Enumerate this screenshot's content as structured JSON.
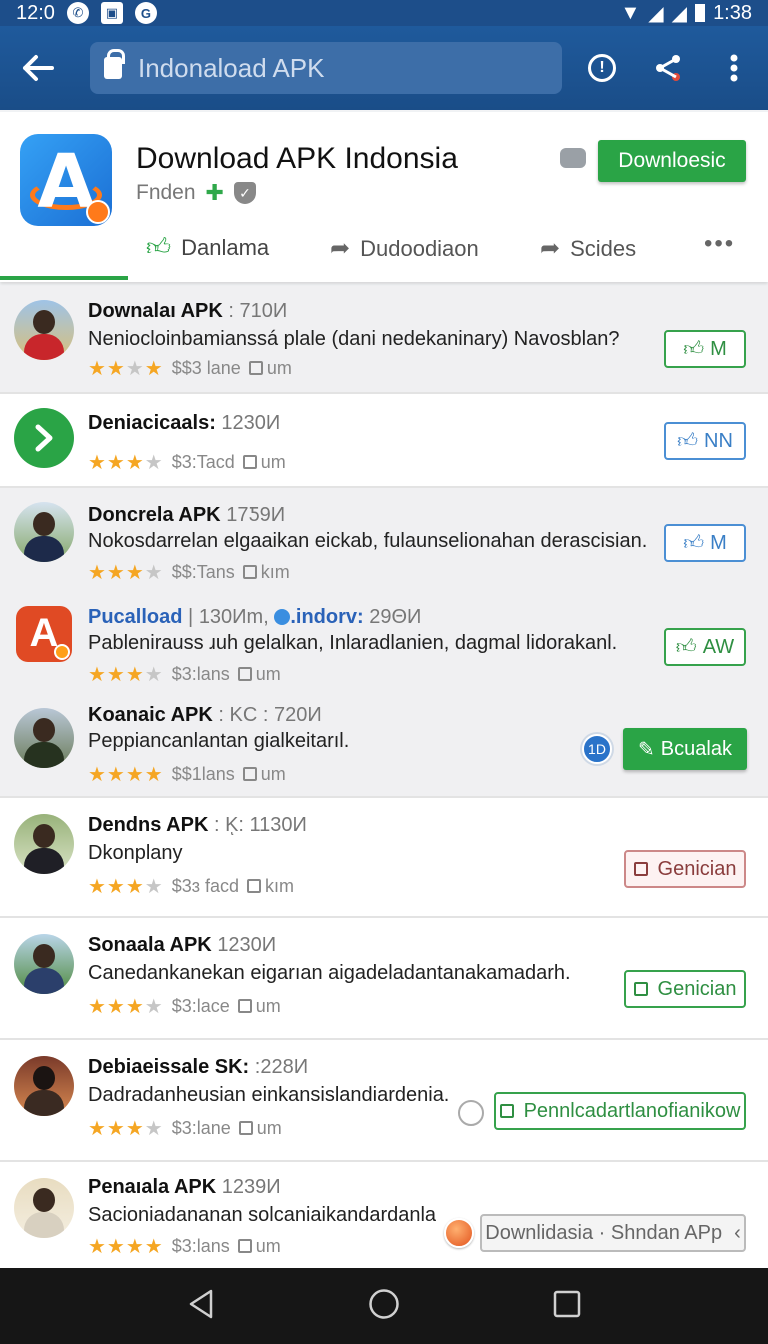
{
  "status_bar": {
    "time_left": "12:0",
    "time_right": "1:38",
    "icons": [
      "whatsapp-icon",
      "gallery-icon",
      "google-icon"
    ]
  },
  "appbar": {
    "search_text": "Indonaload APK"
  },
  "app": {
    "title": "Download APK Indonsia",
    "developer": "Fnden",
    "download_label": "Downloesic"
  },
  "tabs": [
    {
      "label": "Danlama",
      "icon": "thumbs-up-icon"
    },
    {
      "label": "Dudoodiaon",
      "icon": "share-arrow-icon"
    },
    {
      "label": "Scides",
      "icon": "share-arrow-icon"
    }
  ],
  "items": [
    {
      "title": "Downalaı APK",
      "size": ": 710И",
      "desc": "Neniocloinbamianssá plale (dani nedekaninary) Navosblan?",
      "stars": 3,
      "price": "$$3 lane",
      "extra": "um",
      "button": "M",
      "button_style": "green-outline"
    },
    {
      "title": "Deniacicaals:",
      "size": "1230И",
      "desc": "",
      "stars": 3,
      "price": "$3:Tacd",
      "extra": "um",
      "button": "NN",
      "button_style": "blue-outline"
    },
    {
      "title": "Doncrela APK",
      "size": "17Ƽ9И",
      "desc": "Nokosdarrelan elgaaikan eickab, fulaunselionahan derascisian.",
      "stars": 3,
      "price": "$$:Tans",
      "extra": "kım",
      "button": "M",
      "button_style": "blue-outline"
    },
    {
      "title": "Pucalload",
      "size": "130И",
      "title_extra": "130Иm,",
      "title_link": ".indorv:",
      "title_link_size": "29ΘИ",
      "desc": "Pablenirauss ɹuh gelalkan, Inlaradlanien, dagmal lidorakanl.",
      "stars": 3,
      "price": "$3:lans",
      "extra": "um",
      "button": "AW",
      "button_style": "green-outline"
    },
    {
      "title": "Koanaic APK",
      "size": ": KC : 720И",
      "desc": "Peppiancanlantan gialkeitarıl.",
      "stars": 4,
      "price": "$$1lans",
      "extra": "um",
      "button": "Bcualak",
      "button_style": "green-solid",
      "badge": "1D"
    },
    {
      "title": "Dendns APK",
      "size": ": Kͅ: 1130И",
      "desc": "Dkonplany",
      "stars": 3,
      "price": "$3ɜ facd",
      "extra": "kım",
      "button": "Genician",
      "button_style": "red-outline"
    },
    {
      "title": "Sonaala APK",
      "size": "1230И",
      "desc": "Canedankanekan eigarıan aigadeladantanakamadarh.",
      "stars": 3,
      "price": "$3:lace",
      "extra": "um",
      "button": "Genician",
      "button_style": "green-outline"
    },
    {
      "title": "Debiaeissale SK:",
      "size": ":228И",
      "desc": "Dadradanheusian einkansislandiardenia.",
      "stars": 3,
      "price": "$3:lane",
      "extra": "um",
      "button": "Pennlcadartlanofianikow",
      "button_style": "green-outline"
    },
    {
      "title": "Penaıala APK",
      "size": "1239И",
      "desc": "Sacioniadananan solcaniaikandardanla",
      "stars": 4,
      "price": "$3:lans",
      "extra": "um",
      "button": "Downlidasia · Shndan APp",
      "button_style": "gray-outline"
    }
  ]
}
